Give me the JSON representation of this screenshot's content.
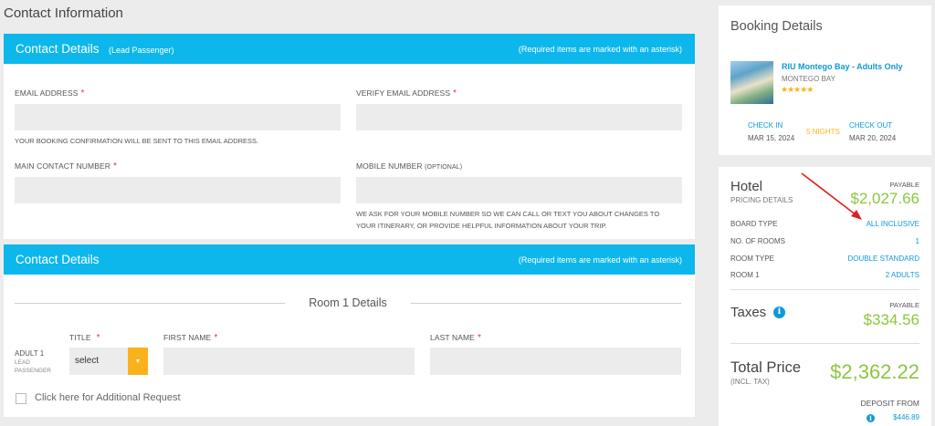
{
  "page": {
    "heading": "Contact Information"
  },
  "contact_panel": {
    "title": "Contact Details",
    "subtitle": "(Lead Passenger)",
    "required_note": "(Required items are marked with an asterisk)",
    "email_label": "EMAIL ADDRESS",
    "verify_email_label": "VERIFY EMAIL ADDRESS",
    "email_hint": "YOUR BOOKING CONFIRMATION WILL BE SENT TO THIS EMAIL ADDRESS.",
    "main_contact_label": "MAIN CONTACT NUMBER",
    "mobile_label": "MOBILE NUMBER",
    "mobile_optional": "(OPTIONAL)",
    "mobile_hint_line1": "WE ASK FOR YOUR MOBILE NUMBER SO WE CAN CALL OR TEXT YOU ABOUT CHANGES TO",
    "mobile_hint_line2": "YOUR ITINERARY, OR PROVIDE HELPFUL INFORMATION ABOUT YOUR TRIP.",
    "asterisk": "*",
    "email_value": "",
    "verify_email_value": "",
    "main_contact_value": "",
    "mobile_value": ""
  },
  "room_panel": {
    "title": "Contact Details",
    "required_note": "(Required items are marked with an asterisk)",
    "room_title": "Room 1 Details",
    "title_label": "TITLE",
    "first_name_label": "FIRST NAME",
    "last_name_label": "LAST NAME",
    "adult_label": "ADULT 1",
    "lead_label_1": "LEAD",
    "lead_label_2": "PASSENGER",
    "title_select_value": "select",
    "first_name_value": "",
    "last_name_value": "",
    "additional_request_label": "Click here for Additional Request"
  },
  "booking": {
    "title": "Booking Details",
    "hotel_name": "RIU Montego Bay - Adults Only",
    "hotel_city": "MONTEGO BAY",
    "stars": "★★★★★",
    "star_rating": 5,
    "check_in_label": "CHECK IN",
    "check_in_date": "MAR 15, 2024",
    "nights": "5 NIGHTS",
    "check_out_label": "CHECK OUT",
    "check_out_date": "MAR 20, 2024"
  },
  "pricing": {
    "hotel_title": "Hotel",
    "hotel_sub": "PRICING DETAILS",
    "payable_label": "PAYABLE",
    "hotel_amount": "$2,027.66",
    "rows": [
      {
        "label": "BOARD TYPE",
        "value": "ALL INCLUSIVE"
      },
      {
        "label": "NO. OF ROOMS",
        "value": "1"
      },
      {
        "label": "ROOM TYPE",
        "value": "DOUBLE STANDARD"
      },
      {
        "label": "ROOM 1",
        "value": "2 ADULTS"
      }
    ],
    "taxes_title": "Taxes",
    "taxes_payable_label": "PAYABLE",
    "taxes_amount": "$334.56",
    "total_title": "Total Price",
    "total_sub": "(INCL. TAX)",
    "total_amount": "$2,362.22",
    "deposit_label": "DEPOSIT FROM",
    "deposit_amount": "$446.89",
    "info_glyph": "i"
  },
  "colors": {
    "accent": "#0db7eb",
    "link": "#0f9ad6",
    "price": "#8cc63f",
    "warning": "#fbb21a",
    "required": "#e53935",
    "annotation_arrow": "#e02020"
  }
}
